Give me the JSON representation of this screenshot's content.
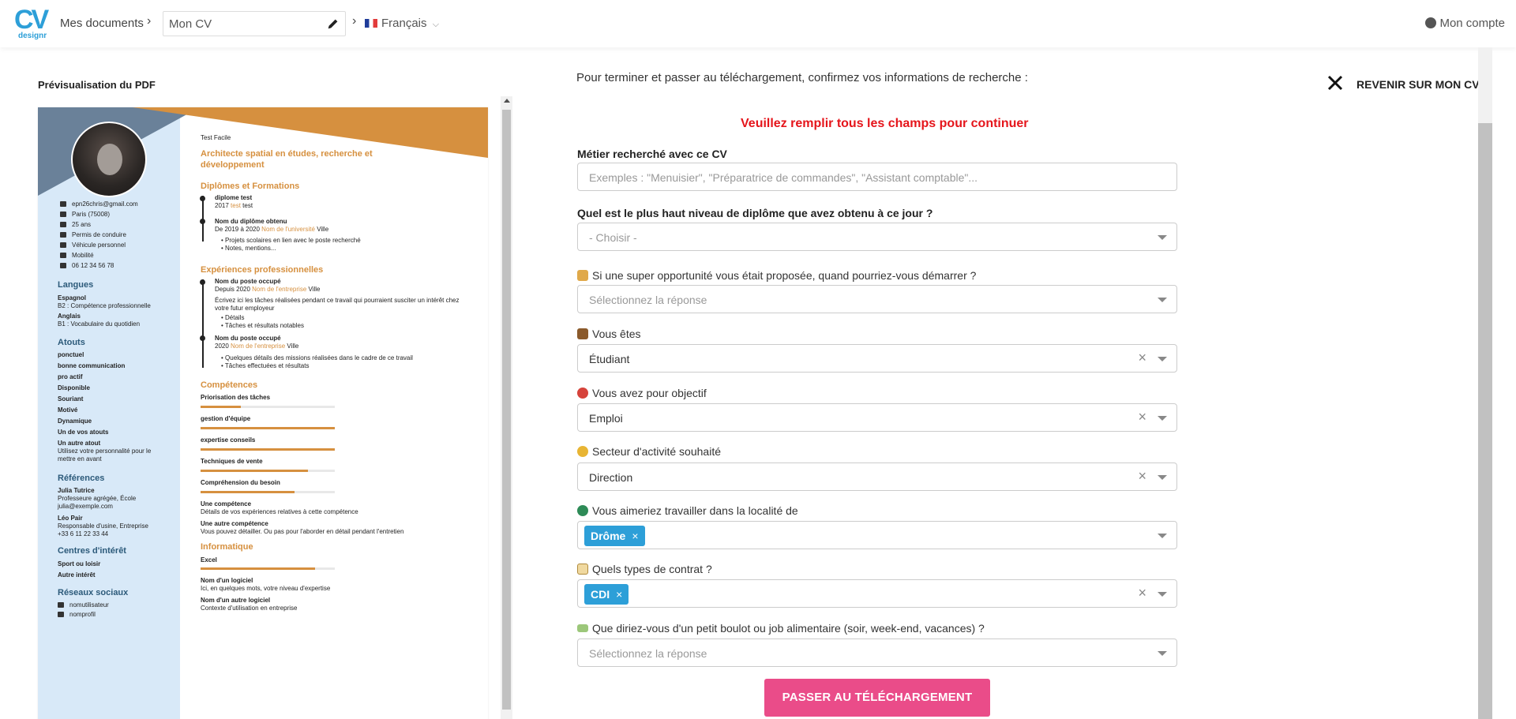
{
  "header": {
    "logo_text": "CV",
    "logo_sub": "designr",
    "my_documents": "Mes documents",
    "doc_name": "Mon CV",
    "language": "Français",
    "account": "Mon compte"
  },
  "preview": {
    "title": "Prévisualisation du PDF",
    "cv": {
      "name": "Test Facile",
      "headline": "Architecte spatial en études, recherche et développement",
      "contact": [
        "epn26chris@gmail.com",
        "Paris (75008)",
        "25 ans",
        "Permis de conduire",
        "Véhicule personnel",
        "Mobilité",
        "06 12 34 56 78"
      ],
      "langues_title": "Langues",
      "langues": [
        {
          "name": "Espagnol",
          "level": "B2 : Compétence professionnelle"
        },
        {
          "name": "Anglais",
          "level": "B1 : Vocabulaire du quotidien"
        }
      ],
      "atouts_title": "Atouts",
      "atouts": [
        "ponctuel",
        "bonne communication",
        "pro actif",
        "Disponible",
        "Souriant",
        "Motivé",
        "Dynamique",
        "Un de vos atouts"
      ],
      "atout_last_title": "Un autre atout",
      "atout_last_desc1": "Utilisez votre personnalité pour le",
      "atout_last_desc2": "mettre en avant",
      "refs_title": "Références",
      "ref1_name": "Julia Tutrice",
      "ref1_line1": "Professeure agrégée, École",
      "ref1_line2": "julia@exemple.com",
      "ref2_name": "Léo Pair",
      "ref2_line1": "Responsable d'usine, Entreprise",
      "ref2_line2": "+33 6 11 22 33 44",
      "interets_title": "Centres d'intérêt",
      "interets": [
        "Sport ou loisir",
        "Autre intérêt"
      ],
      "reseaux_title": "Réseaux sociaux",
      "reseaux": [
        "nomutilisateur",
        "nomprofil"
      ],
      "diplomes_title": "Diplômes et Formations",
      "d1_title": "diplome test",
      "d1_year": "2017",
      "d1_school": "test",
      "d1_city": "test",
      "d2_title": "Nom du diplôme obtenu",
      "d2_dates": "De 2019 à 2020",
      "d2_school": "Nom de l'université",
      "d2_city": "Ville",
      "d2_b1": "Projets scolaires en lien avec le poste recherché",
      "d2_b2": "Notes, mentions...",
      "exp_title": "Expériences professionnelles",
      "e1_title": "Nom du poste occupé",
      "e1_dates": "Depuis 2020",
      "e1_company": "Nom de l'entreprise",
      "e1_city": "Ville",
      "e1_desc1": "Écrivez ici les tâches réalisées pendant ce travail qui pourraient susciter un intérêt chez",
      "e1_desc2": "votre futur employeur",
      "e1_b1": "Détails",
      "e1_b2": "Tâches et résultats notables",
      "e2_title": "Nom du poste occupé",
      "e2_dates": "2020",
      "e2_company": "Nom de l'entreprise",
      "e2_city": "Ville",
      "e2_b1": "Quelques détails des missions réalisées dans le cadre de ce travail",
      "e2_b2": "Tâches effectuées et résultats",
      "comp_title": "Compétences",
      "skills": [
        {
          "name": "Priorisation des tâches",
          "level": 0.3
        },
        {
          "name": "gestion d'équipe",
          "level": 1.0
        },
        {
          "name": "expertise conseils",
          "level": 1.0
        },
        {
          "name": "Techniques de vente",
          "level": 0.8
        },
        {
          "name": "Compréhension du besoin",
          "level": 0.7
        }
      ],
      "c1_title": "Une compétence",
      "c1_desc": "Détails de vos expériences relatives à cette compétence",
      "c2_title": "Une autre compétence",
      "c2_desc": "Vous pouvez détailler. Ou pas pour l'aborder en détail pendant l'entretien",
      "info_title": "Informatique",
      "i1_name": "Excel",
      "i1_level": 0.85,
      "i2_title": "Nom d'un logiciel",
      "i2_desc": "Ici, en quelques mots, votre niveau d'expertise",
      "i3_title": "Nom d'un autre logiciel",
      "i3_desc": "Contexte d'utilisation en entreprise"
    }
  },
  "form": {
    "intro": "Pour terminer et passer au téléchargement, confirmez vos informations de recherche :",
    "back": "REVENIR SUR MON CV",
    "warning": "Veuillez remplir tous les champs pour continuer",
    "q_job": "Métier recherché avec ce CV",
    "q_job_placeholder": "Exemples : \"Menuisier\", \"Préparatrice de commandes\", \"Assistant comptable\"...",
    "q_degree": "Quel est le plus haut niveau de diplôme que avez obtenu à ce jour ?",
    "q_degree_value": "- Choisir -",
    "q_start": "Si une super opportunité vous était proposée, quand pourriez-vous démarrer ?",
    "q_start_placeholder": "Sélectionnez la réponse",
    "q_you_are": "Vous êtes",
    "q_you_are_value": "Étudiant",
    "q_goal": "Vous avez pour objectif",
    "q_goal_value": "Emploi",
    "q_sector": "Secteur d'activité souhaité",
    "q_sector_value": "Direction",
    "q_location": "Vous aimeriez travailler dans la localité de",
    "q_location_chip": "Drôme",
    "q_contract": "Quels types de contrat ?",
    "q_contract_chip": "CDI",
    "q_sidejob": "Que diriez-vous d'un petit boulot ou job alimentaire (soir, week-end, vacances) ?",
    "q_sidejob_placeholder": "Sélectionnez la réponse",
    "submit": "PASSER AU TÉLÉCHARGEMENT",
    "chip_remove": "×",
    "clear": "×"
  },
  "colors": {
    "brand": "#2d9fd8",
    "accent_orange": "#d6903f",
    "warning_red": "#e5151b",
    "submit_pink": "#ea4c89",
    "cv_sidebar": "#d8e9f8"
  },
  "icons": {
    "pencil": "pencil-icon",
    "chevron": "chevron-right-icon",
    "user": "user-circle-icon",
    "close": "close-icon",
    "hourglass": "hourglass-icon",
    "briefcase": "briefcase-icon",
    "target": "target-icon",
    "clock": "clock-icon",
    "globe": "globe-icon",
    "memo": "memo-icon",
    "money": "money-icon"
  }
}
